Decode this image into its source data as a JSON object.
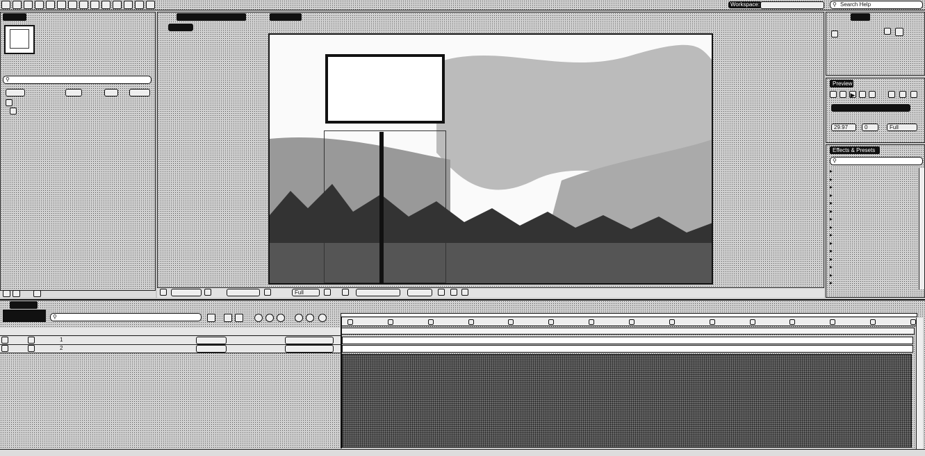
{
  "menubar": {
    "workspace_label": "Workspace:",
    "workspace_value": "",
    "search_placeholder": "Search Help",
    "tool_icons": [
      "selection-tool-icon",
      "hand-tool-icon",
      "zoom-tool-icon",
      "rotation-tool-icon",
      "camera-tool-icon",
      "pan-behind-icon",
      "rectangle-tool-icon",
      "pen-tool-icon",
      "type-tool-icon",
      "brush-tool-icon",
      "clone-stamp-icon",
      "eraser-icon",
      "roto-brush-icon",
      "puppet-tool-icon"
    ]
  },
  "project_panel": {
    "tab_label": "",
    "search_placeholder": "",
    "columns": [
      "",
      "",
      "",
      ""
    ],
    "items": [
      {
        "name": "",
        "type": ""
      },
      {
        "name": "",
        "type": ""
      }
    ]
  },
  "composition_panel": {
    "tab_label": "",
    "layer_tab_label": "",
    "comp_button": "",
    "bottom_zoom": "",
    "bottom_time": "",
    "bottom_resolution": "Full",
    "bottom_view": ""
  },
  "info_panel": {
    "tab_label": ""
  },
  "preview_panel": {
    "tab_label": "Preview",
    "ram_preview_options": "",
    "frame_rate_label": "",
    "frame_rate_value": "29.97",
    "skip_label": "",
    "skip_value": "0",
    "resolution_label": "",
    "resolution_value": "Full",
    "from_current_time_label": "",
    "full_screen_label": ""
  },
  "effects_panel": {
    "tab_label": "Effects & Presets",
    "search_placeholder": "",
    "categories": [
      "",
      "",
      "",
      "",
      "",
      "",
      "",
      "",
      "",
      "",
      "",
      "",
      "",
      "",
      ""
    ]
  },
  "timeline": {
    "tab_label": "",
    "timecode": "",
    "search_placeholder": "",
    "columns": [
      "",
      "",
      "",
      "",
      ""
    ],
    "layers": [
      {
        "index": "1",
        "name": "",
        "mode": "",
        "parent": ""
      },
      {
        "index": "2",
        "name": "",
        "mode": "",
        "parent": ""
      }
    ],
    "ruler_ticks": [
      "",
      "",
      "",
      "",
      "",
      "",
      "",
      "",
      "",
      "",
      "",
      "",
      "",
      "",
      ""
    ]
  }
}
